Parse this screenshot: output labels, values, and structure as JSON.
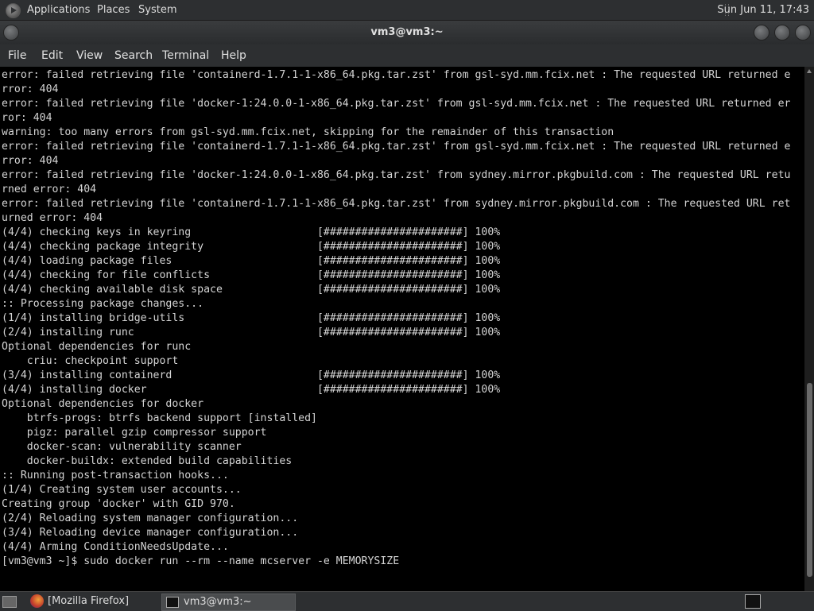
{
  "top_panel": {
    "menus": [
      "Applications",
      "Places",
      "System"
    ],
    "clock": "Sun Jun 11, 17:43"
  },
  "window": {
    "title": "vm3@vm3:~"
  },
  "menubar": [
    "File",
    "Edit",
    "View",
    "Search",
    "Terminal",
    "Help"
  ],
  "terminal": {
    "lines": [
      "error: failed retrieving file 'containerd-1.7.1-1-x86_64.pkg.tar.zst' from gsl-syd.mm.fcix.net : The requested URL returned e",
      "rror: 404",
      "error: failed retrieving file 'docker-1:24.0.0-1-x86_64.pkg.tar.zst' from gsl-syd.mm.fcix.net : The requested URL returned er",
      "ror: 404",
      "warning: too many errors from gsl-syd.mm.fcix.net, skipping for the remainder of this transaction",
      "error: failed retrieving file 'containerd-1.7.1-1-x86_64.pkg.tar.zst' from gsl-syd.mm.fcix.net : The requested URL returned e",
      "rror: 404",
      "error: failed retrieving file 'docker-1:24.0.0-1-x86_64.pkg.tar.zst' from sydney.mirror.pkgbuild.com : The requested URL retu",
      "rned error: 404",
      "error: failed retrieving file 'containerd-1.7.1-1-x86_64.pkg.tar.zst' from sydney.mirror.pkgbuild.com : The requested URL ret",
      "urned error: 404",
      "(4/4) checking keys in keyring                    [######################] 100%",
      "(4/4) checking package integrity                  [######################] 100%",
      "(4/4) loading package files                       [######################] 100%",
      "(4/4) checking for file conflicts                 [######################] 100%",
      "(4/4) checking available disk space               [######################] 100%",
      ":: Processing package changes...",
      "(1/4) installing bridge-utils                     [######################] 100%",
      "(2/4) installing runc                             [######################] 100%",
      "Optional dependencies for runc",
      "    criu: checkpoint support",
      "(3/4) installing containerd                       [######################] 100%",
      "(4/4) installing docker                           [######################] 100%",
      "Optional dependencies for docker",
      "    btrfs-progs: btrfs backend support [installed]",
      "    pigz: parallel gzip compressor support",
      "    docker-scan: vulnerability scanner",
      "    docker-buildx: extended build capabilities",
      ":: Running post-transaction hooks...",
      "(1/4) Creating system user accounts...",
      "Creating group 'docker' with GID 970.",
      "(2/4) Reloading system manager configuration...",
      "(3/4) Reloading device manager configuration...",
      "(4/4) Arming ConditionNeedsUpdate...",
      "[vm3@vm3 ~]$ sudo docker run --rm --name mcserver -e MEMORYSIZE"
    ]
  },
  "taskbar": {
    "firefox_task": "[Mozilla Firefox]",
    "terminal_task": "vm3@vm3:~"
  }
}
